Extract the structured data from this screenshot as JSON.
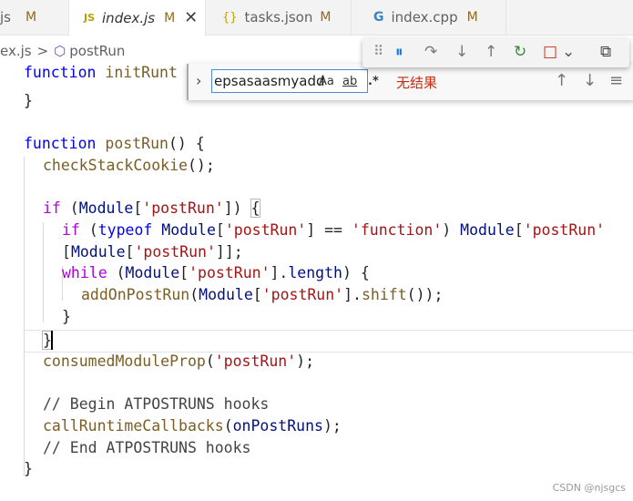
{
  "tabs": [
    {
      "label": "js",
      "modified": "M"
    },
    {
      "icon": "JS",
      "label": "index.js",
      "modified": "M",
      "close": "✕"
    },
    {
      "icon": "{}",
      "label": "tasks.json",
      "modified": "M"
    },
    {
      "icon": "G",
      "label": "index.cpp",
      "modified": "M"
    }
  ],
  "breadcrumb": {
    "file": "ex.js",
    "separator": ">",
    "symbol": "postRun"
  },
  "find": {
    "value": "epsasaasmyadd",
    "match_case": "Aa",
    "whole_word": "ab",
    "regex": ".*",
    "result": "无结果",
    "prev": "↑",
    "next": "↓",
    "more": "≡"
  },
  "debug_toolbar": {
    "grip": "⠿",
    "pause": "⏸",
    "step_over": "↷",
    "step_into": "↓",
    "step_out": "↑",
    "restart": "↻",
    "stop": "□",
    "dropdown": "⌄",
    "disconnect": "⧉"
  },
  "code": {
    "l1": {
      "kw": "function",
      "name": "initRunt"
    },
    "l2": "}",
    "l4": {
      "kw": "function",
      "name": "postRun",
      "rest": "() {"
    },
    "l5": {
      "fn": "checkStackCookie",
      "rest": "();"
    },
    "l7": {
      "kw": "if",
      "a": " (",
      "id": "Module",
      "b": "[",
      "s": "'postRun'",
      "c": "]) ",
      "brace": "{"
    },
    "l8": {
      "kw": "if",
      "a": " (",
      "kw2": "typeof",
      "b": " ",
      "id": "Module",
      "c": "[",
      "s": "'postRun'",
      "d": "] == ",
      "s2": "'function'",
      "e": ") ",
      "id2": "Module",
      "f": "[",
      "s3": "'postRun'"
    },
    "l9": {
      "a": "[",
      "id": "Module",
      "b": "[",
      "s": "'postRun'",
      "c": "]];"
    },
    "l10": {
      "kw": "while",
      "a": " (",
      "id": "Module",
      "b": "[",
      "s": "'postRun'",
      "c": "].",
      "id2": "length",
      "d": ") {"
    },
    "l11": {
      "fn": "addOnPostRun",
      "a": "(",
      "id": "Module",
      "b": "[",
      "s": "'postRun'",
      "c": "].",
      "fn2": "shift",
      "d": "());"
    },
    "l12": "}",
    "l13": "}",
    "l14": {
      "fn": "consumedModuleProp",
      "a": "(",
      "s": "'postRun'",
      "b": ");"
    },
    "l16": "// Begin ATPOSTRUNS hooks",
    "l17": {
      "fn": "callRuntimeCallbacks",
      "a": "(",
      "id": "onPostRuns",
      "b": ");"
    },
    "l18": "// End ATPOSTRUNS hooks",
    "l19": "}"
  },
  "watermark": "CSDN @njsgcs"
}
